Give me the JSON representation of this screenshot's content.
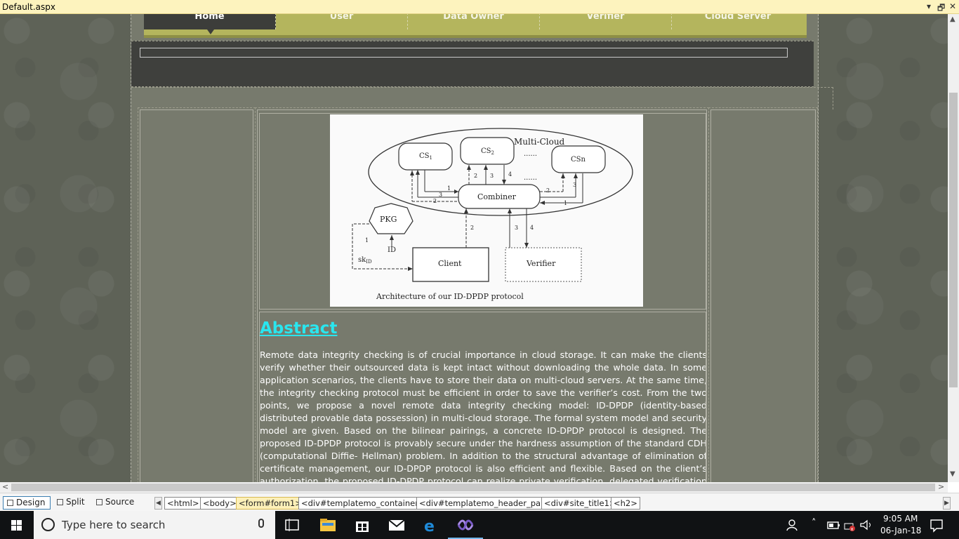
{
  "document": {
    "tab_title": "Default.aspx"
  },
  "nav": {
    "items": [
      {
        "label": "Home",
        "active": true
      },
      {
        "label": "User",
        "active": false
      },
      {
        "label": "Data Owner",
        "active": false
      },
      {
        "label": "Verifier",
        "active": false
      },
      {
        "label": "Cloud Server",
        "active": false
      }
    ]
  },
  "figure": {
    "multi_cloud": "Multi-Cloud",
    "cs1": "CS",
    "cs1_sub": "1",
    "cs2": "CS",
    "cs2_sub": "2",
    "csn": "CSn",
    "dots": "......",
    "combiner": "Combiner",
    "pkg": "PKG",
    "id": "ID",
    "sk": "sk",
    "sk_sub": "ID",
    "client": "Client",
    "verifier": "Verifier",
    "caption": "Architecture of our ID-DPDP protocol",
    "n1": "1",
    "n2": "2",
    "n3": "3",
    "n4": "4"
  },
  "abstract": {
    "title": "Abstract",
    "body": "Remote data integrity checking is of crucial importance in cloud storage. It can make the clients verify whether their outsourced data is kept intact without downloading the whole data. In some application scenarios, the clients have to store their data on multi-cloud servers. At the same time, the integrity checking protocol must be efficient in order to save the verifier’s cost. From the two points, we propose a novel remote data integrity checking model: ID-DPDP (identity-based distributed provable data possession) in multi-cloud storage. The formal system model and security model are given. Based on the bilinear pairings, a concrete ID-DPDP protocol is designed. The proposed ID-DPDP protocol is provably secure under the hardness assumption of the standard CDH (computational Diffie- Hellman) problem. In addition to the structural advantage of elimination of certificate management, our ID-DPDP protocol is also efficient and flexible. Based on the client’s authorization, the proposed ID-DPDP protocol can realize private verification, delegated verification and public verification."
  },
  "viewbar": {
    "design": "Design",
    "split": "Split",
    "source": "Source",
    "tags": [
      "<html>",
      "<body>",
      "<form#form1>",
      "<div#templatemo_container>",
      "<div#templatemo_header_pa...>",
      "<div#site_title1>",
      "<h2>"
    ],
    "selected_tag": "<form#form1>"
  },
  "taskbar": {
    "search_placeholder": "Type here to search",
    "time": "9:05 AM",
    "date": "06-Jan-18"
  },
  "colors": {
    "abstract_title": "#29e6ef",
    "menu_bg": "#b4b55d",
    "menu_active": "#3c3d3a",
    "content_bg": "#777a6d"
  }
}
